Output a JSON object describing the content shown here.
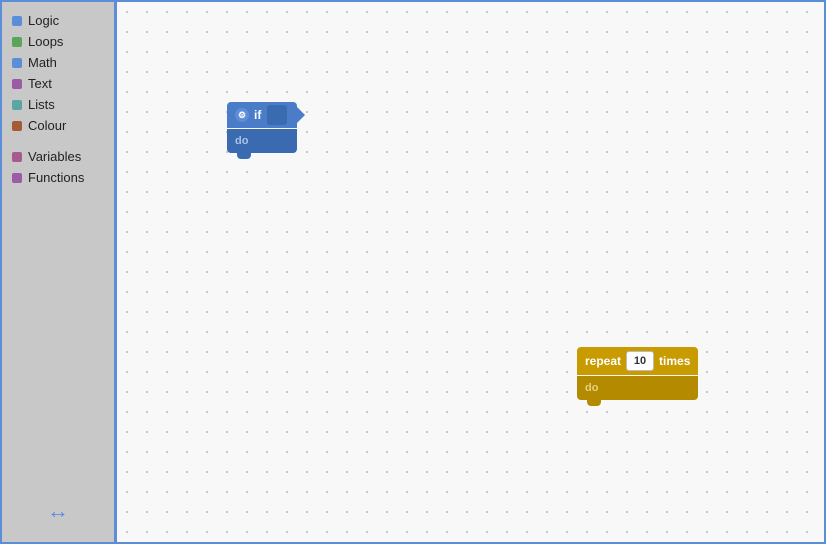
{
  "sidebar": {
    "items": [
      {
        "id": "logic",
        "label": "Logic",
        "color": "#5b8dd9"
      },
      {
        "id": "loops",
        "label": "Loops",
        "color": "#5ba55b"
      },
      {
        "id": "math",
        "label": "Math",
        "color": "#5b8dd9"
      },
      {
        "id": "text",
        "label": "Text",
        "color": "#9c5ba5"
      },
      {
        "id": "lists",
        "label": "Lists",
        "color": "#5ba5a5"
      },
      {
        "id": "colour",
        "label": "Colour",
        "color": "#a55b35"
      },
      {
        "id": "variables",
        "label": "Variables",
        "color": "#a55b8d"
      },
      {
        "id": "functions",
        "label": "Functions",
        "color": "#9c5ba5"
      }
    ],
    "resize_arrow": "↔"
  },
  "blocks": {
    "if_block": {
      "gear_icon": "⚙",
      "if_label": "if",
      "do_label": "do"
    },
    "repeat_block": {
      "repeat_label": "repeat",
      "value": "10",
      "times_label": "times",
      "do_label": "do"
    }
  },
  "colors": {
    "if_block_bg": "#4a7cc7",
    "if_block_dark": "#3a6ab0",
    "repeat_block_bg": "#c89b00",
    "repeat_block_dark": "#b38a00",
    "sidebar_bg": "#c8c8c8",
    "workspace_bg": "#f8f8f8",
    "border_color": "#5b8dd9"
  }
}
